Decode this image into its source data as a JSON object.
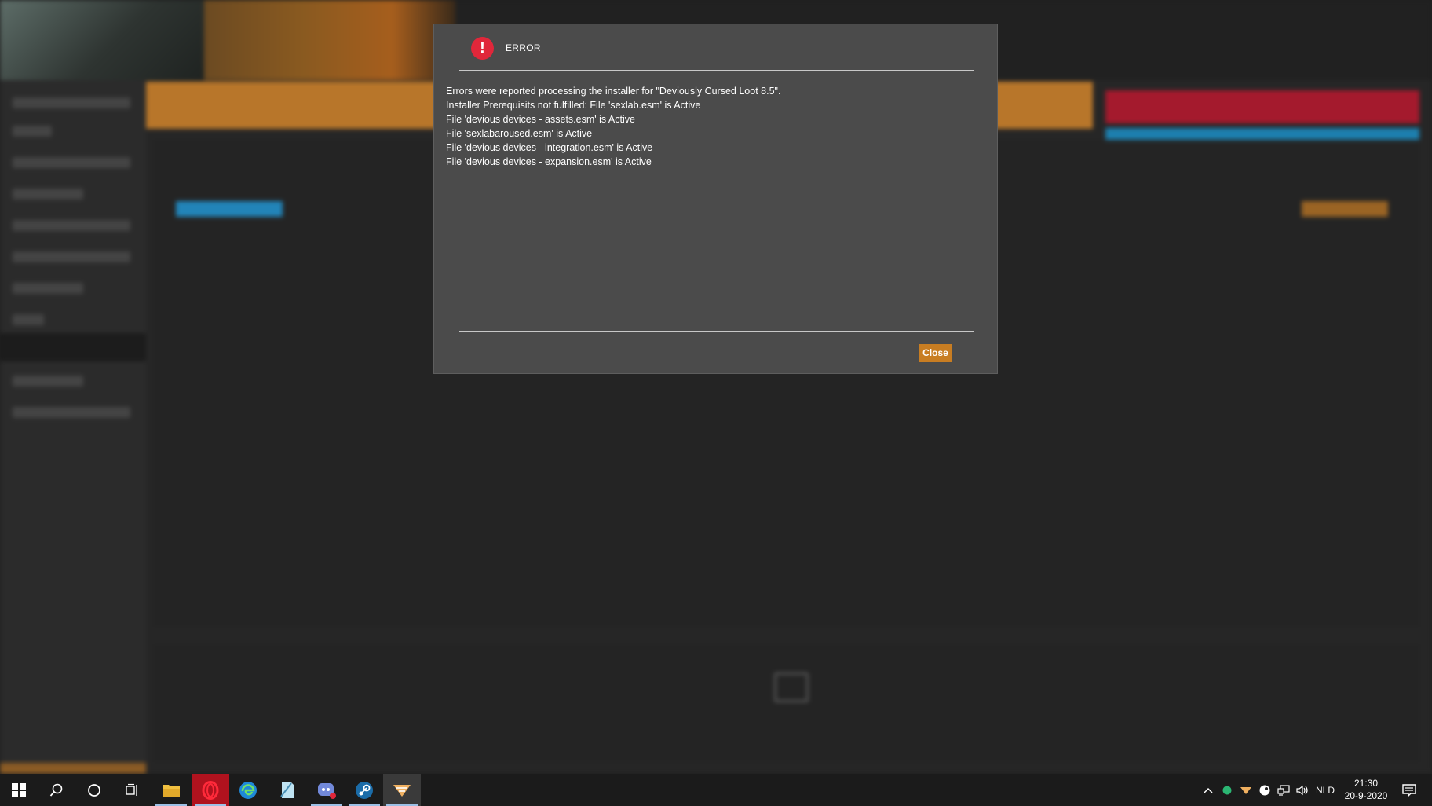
{
  "dialog": {
    "title": "ERROR",
    "icon": "error-exclamation-icon",
    "message_lines": [
      "Errors were reported processing the installer for \"Deviously Cursed Loot 8.5\".",
      "Installer Prerequisits not fulfilled: File 'sexlab.esm' is Active",
      "File 'devious devices - assets.esm' is Active",
      "File 'sexlabaroused.esm' is Active",
      "File 'devious devices - integration.esm' is Active",
      "File 'devious devices - expansion.esm' is Active"
    ],
    "close_label": "Close",
    "accent_color": "#c87d22",
    "error_color": "#e0273a"
  },
  "taskbar": {
    "language": "NLD",
    "time": "21:30",
    "date": "20-9-2020"
  }
}
